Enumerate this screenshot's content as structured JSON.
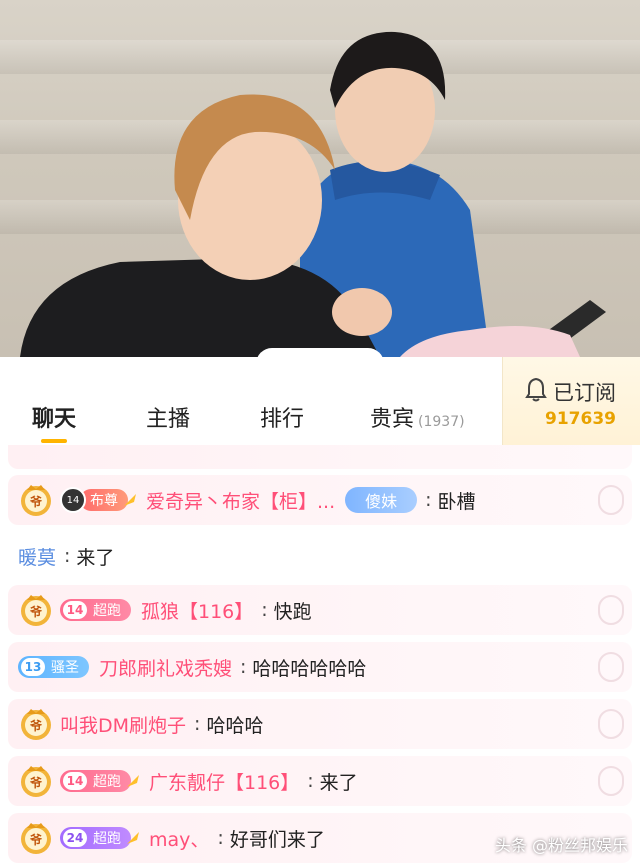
{
  "tabs": [
    {
      "label": "聊天",
      "active": true
    },
    {
      "label": "主播"
    },
    {
      "label": "排行"
    },
    {
      "label": "贵宾",
      "count": "(1937)"
    }
  ],
  "subscribe": {
    "label": "已订阅",
    "count": "917639",
    "icon": "bell-icon"
  },
  "chat": [
    {
      "id": "r1",
      "crest": true,
      "level": "14",
      "badge": "布尊",
      "name": "爱奇异丶布家【柜】...",
      "tag": "傻妹",
      "msg": "卧槽"
    },
    {
      "id": "r2",
      "name": "暖莫",
      "msg": "来了"
    },
    {
      "id": "r3",
      "crest": true,
      "level": "14",
      "badge": "超跑",
      "name": "孤狼【116】",
      "msg": "快跑"
    },
    {
      "id": "r4",
      "level": "13",
      "badge": "骚圣",
      "name": "刀郎刷礼戏秃嫂",
      "msg": "哈哈哈哈哈哈"
    },
    {
      "id": "r5",
      "crest": true,
      "name": "叫我DM刷炮子",
      "msg": "哈哈哈"
    },
    {
      "id": "r6",
      "crest": true,
      "level": "14",
      "badge": "超跑",
      "name": "广东靓仔【116】",
      "msg": "来了"
    },
    {
      "id": "r7",
      "crest": true,
      "level": "24",
      "badge": "超跑",
      "name": "may、",
      "msg": "好哥们来了"
    }
  ],
  "crest_label": "爷",
  "watermark": "头条 @粉丝邦娱乐",
  "colors": {
    "accent": "#ffb400",
    "name_pink": "#ff4f78",
    "name_blue": "#5a8de0",
    "sub_count": "#e8a200"
  }
}
